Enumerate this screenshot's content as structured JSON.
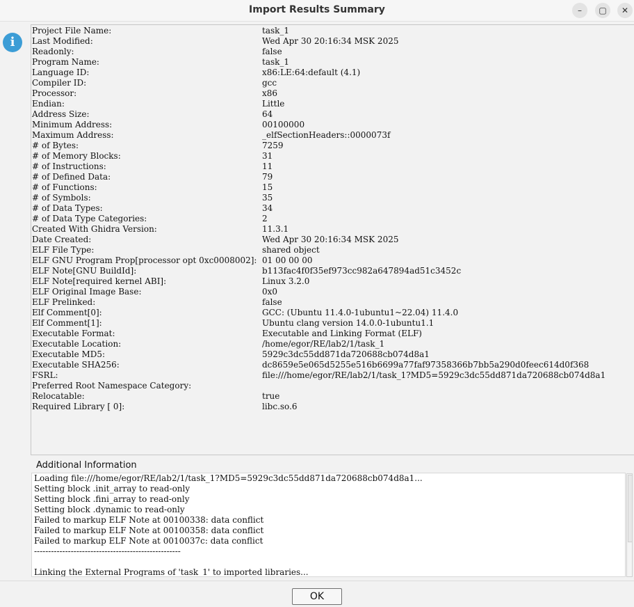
{
  "window": {
    "title": "Import Results Summary",
    "controls": {
      "minimize": "–",
      "maximize": "▢",
      "close": "✕"
    }
  },
  "info_icon": {
    "glyph": "i",
    "color": "#3c9dd6"
  },
  "properties": [
    {
      "key": "Project File Name:",
      "value": "task_1"
    },
    {
      "key": "Last Modified:",
      "value": "Wed Apr 30 20:16:34 MSK 2025"
    },
    {
      "key": "Readonly:",
      "value": "false"
    },
    {
      "key": "Program Name:",
      "value": "task_1"
    },
    {
      "key": "Language ID:",
      "value": "x86:LE:64:default (4.1)"
    },
    {
      "key": "Compiler ID:",
      "value": "gcc"
    },
    {
      "key": "Processor:",
      "value": "x86"
    },
    {
      "key": "Endian:",
      "value": "Little"
    },
    {
      "key": "Address Size:",
      "value": "64"
    },
    {
      "key": "Minimum Address:",
      "value": "00100000"
    },
    {
      "key": "Maximum Address:",
      "value": "_elfSectionHeaders::0000073f"
    },
    {
      "key": "# of Bytes:",
      "value": "7259"
    },
    {
      "key": "# of Memory Blocks:",
      "value": "31"
    },
    {
      "key": "# of Instructions:",
      "value": "11"
    },
    {
      "key": "# of Defined Data:",
      "value": "79"
    },
    {
      "key": "# of Functions:",
      "value": "15"
    },
    {
      "key": "# of Symbols:",
      "value": "35"
    },
    {
      "key": "# of Data Types:",
      "value": "34"
    },
    {
      "key": "# of Data Type Categories:",
      "value": "2"
    },
    {
      "key": "Created With Ghidra Version:",
      "value": "11.3.1"
    },
    {
      "key": "Date Created:",
      "value": "Wed Apr 30 20:16:34 MSK 2025"
    },
    {
      "key": "ELF File Type:",
      "value": "shared object"
    },
    {
      "key": "ELF GNU Program Prop[processor opt 0xc0008002]:",
      "value": "01 00 00 00"
    },
    {
      "key": "ELF Note[GNU BuildId]:",
      "value": "b113fac4f0f35ef973cc982a647894ad51c3452c"
    },
    {
      "key": "ELF Note[required kernel ABI]:",
      "value": "Linux 3.2.0"
    },
    {
      "key": "ELF Original Image Base:",
      "value": "0x0"
    },
    {
      "key": "ELF Prelinked:",
      "value": "false"
    },
    {
      "key": "Elf Comment[0]:",
      "value": "GCC: (Ubuntu 11.4.0-1ubuntu1~22.04) 11.4.0"
    },
    {
      "key": "Elf Comment[1]:",
      "value": "Ubuntu clang version 14.0.0-1ubuntu1.1"
    },
    {
      "key": "Executable Format:",
      "value": "Executable and Linking Format (ELF)"
    },
    {
      "key": "Executable Location:",
      "value": "/home/egor/RE/lab2/1/task_1"
    },
    {
      "key": "Executable MD5:",
      "value": "5929c3dc55dd871da720688cb074d8a1"
    },
    {
      "key": "Executable SHA256:",
      "value": "dc8659e5e065d5255e516b6699a77faf97358366b7bb5a290d0feec614d0f368"
    },
    {
      "key": "FSRL:",
      "value": "file:///home/egor/RE/lab2/1/task_1?MD5=5929c3dc55dd871da720688cb074d8a1"
    },
    {
      "key": "Preferred Root Namespace Category:",
      "value": ""
    },
    {
      "key": "Relocatable:",
      "value": "true"
    },
    {
      "key": "Required Library [    0]:",
      "value": "libc.so.6"
    }
  ],
  "additional_info": {
    "label": "Additional Information",
    "lines": [
      "Loading file:///home/egor/RE/lab2/1/task_1?MD5=5929c3dc55dd871da720688cb074d8a1...",
      "Setting block .init_array to read-only",
      "Setting block .fini_array to read-only",
      "Setting block .dynamic to read-only",
      "Failed to markup ELF Note at 00100338: data conflict",
      "Failed to markup ELF Note at 00100358: data conflict",
      "Failed to markup ELF Note at 0010037c: data conflict",
      "----------------------------------------------------",
      "",
      "Linking the External Programs of 'task_1' to imported libraries..."
    ]
  },
  "buttons": {
    "ok": "OK"
  }
}
